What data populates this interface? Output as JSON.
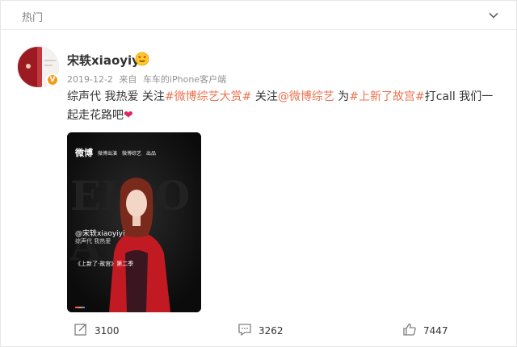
{
  "section": {
    "title": "热门"
  },
  "post": {
    "username": "宋轶xiaoyiyi",
    "verified_badge": "V",
    "date": "2019-12-2",
    "source_prefix": "来自",
    "source": "车车的iPhone客户端",
    "content": {
      "t1": "综声代 我热爱 关注",
      "tag1": "#微博综艺大赏#",
      "t2": "关注",
      "mention": "@微博综艺",
      "t3": "为",
      "tag2": "#上新了故宫#",
      "t4": "打call 我们一起走花路吧",
      "heart": "❤"
    },
    "media": {
      "logo": "微博",
      "partners": [
        "微博出演",
        "微博综艺",
        "出品"
      ],
      "bg_text": "EIBO",
      "overlay_name": "@宋轶xiaoyiyi",
      "overlay_sub": "综声代 我热爱",
      "show_title": "《上新了·故宫》第二季"
    }
  },
  "actions": {
    "reposts": "3100",
    "comments": "3262",
    "likes": "7447"
  },
  "colors": {
    "link": "#eb7350",
    "verify": "#f59d1a",
    "meta": "#939393"
  }
}
